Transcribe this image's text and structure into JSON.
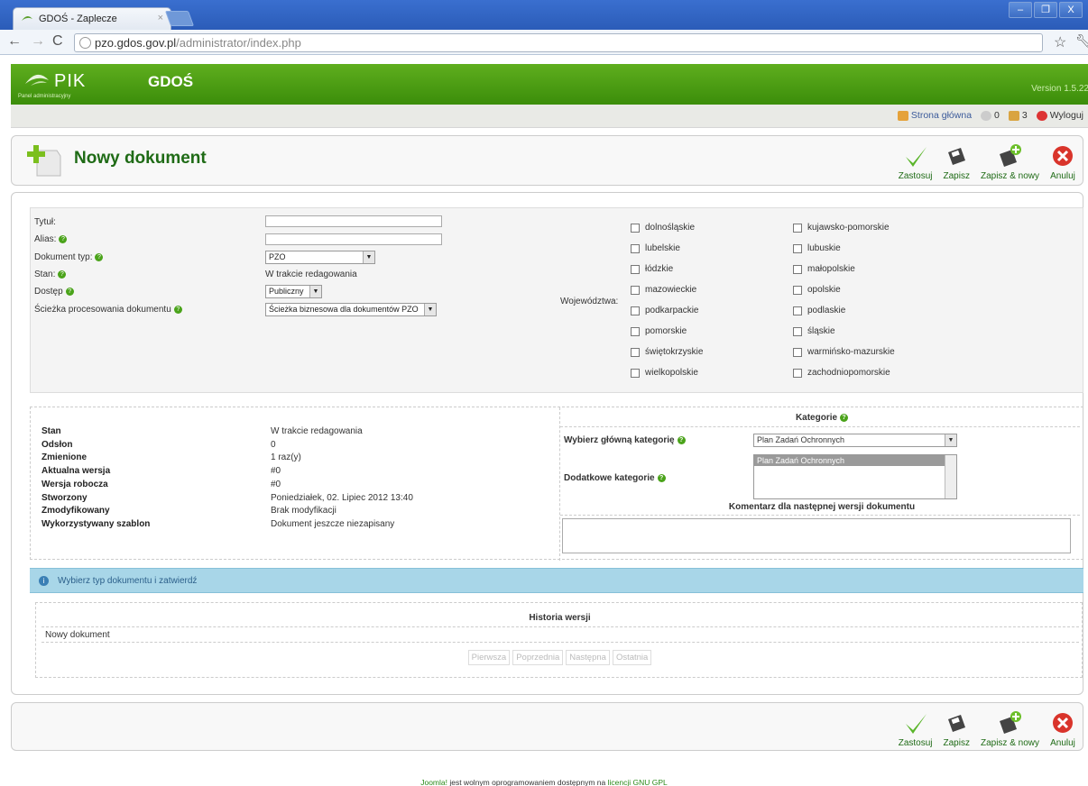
{
  "browser": {
    "tab_title": "GDOŚ - Zaplecze",
    "tab_close": "×",
    "url_host": "pzo.gdos.gov.pl",
    "url_path": "/administrator/index.php",
    "window_buttons": [
      "–",
      "❐",
      "X"
    ]
  },
  "header": {
    "logo_text": "PIK",
    "logo_sub": "Panel administracyjny",
    "site_name": "GDOŚ",
    "version": "Version 1.5.22",
    "brand_color": "#4a9e14"
  },
  "status": {
    "home_link": "Strona główna",
    "messages_count": "0",
    "users_count": "3",
    "logout": "Wyloguj"
  },
  "toolbar": {
    "page_title": "Nowy dokument",
    "apply": "Zastosuj",
    "save": "Zapisz",
    "save_new": "Zapisz & nowy",
    "cancel": "Anuluj"
  },
  "form": {
    "title_label": "Tytuł:",
    "alias_label": "Alias:",
    "doctype_label": "Dokument typ:",
    "doctype_value": "PZO",
    "state_label": "Stan:",
    "state_value": "W trakcie redagowania",
    "access_label": "Dostęp",
    "access_value": "Publiczny",
    "path_label": "Ścieżka procesowania dokumentu",
    "path_value": "Ścieżka biznesowa dla dokumentów PZO",
    "voivodeships_label": "Województwa:",
    "voivodeships_left": [
      "dolnośląskie",
      "lubelskie",
      "łódzkie",
      "mazowieckie",
      "podkarpackie",
      "pomorskie",
      "świętokrzyskie",
      "wielkopolskie"
    ],
    "voivodeships_right": [
      "kujawsko-pomorskie",
      "lubuskie",
      "małopolskie",
      "opolskie",
      "podlaskie",
      "śląskie",
      "warmińsko-mazurskie",
      "zachodniopomorskie"
    ]
  },
  "info": {
    "rows": [
      {
        "k": "Stan",
        "v": "W trakcie redagowania"
      },
      {
        "k": "Odsłon",
        "v": "0"
      },
      {
        "k": "Zmienione",
        "v": "1 raz(y)"
      },
      {
        "k": "Aktualna wersja",
        "v": "#0"
      },
      {
        "k": "Wersja robocza",
        "v": "#0"
      },
      {
        "k": "Stworzony",
        "v": "Poniedziałek, 02. Lipiec 2012 13:40"
      },
      {
        "k": "Zmodyfikowany",
        "v": "Brak modyfikacji"
      },
      {
        "k": "Wykorzystywany szablon",
        "v": "Dokument jeszcze niezapisany"
      }
    ]
  },
  "categories": {
    "title": "Kategorie",
    "main_label": "Wybierz główną kategorię",
    "main_value": "Plan Zadań Ochronnych",
    "additional_label": "Dodatkowe kategorie",
    "additional_selected": "Plan Zadań Ochronnych",
    "comment_title": "Komentarz dla następnej wersji dokumentu"
  },
  "notice": {
    "text": "Wybierz typ dokumentu i zatwierdź"
  },
  "history": {
    "title": "Historia wersji",
    "row": "Nowy dokument",
    "pager": [
      "Pierwsza",
      "Poprzednia",
      "Następna",
      "Ostatnia"
    ]
  },
  "footer": {
    "joomla": "Joomla!",
    "text": " jest wolnym oprogramowaniem dostępnym na ",
    "license": "licencji GNU GPL"
  }
}
